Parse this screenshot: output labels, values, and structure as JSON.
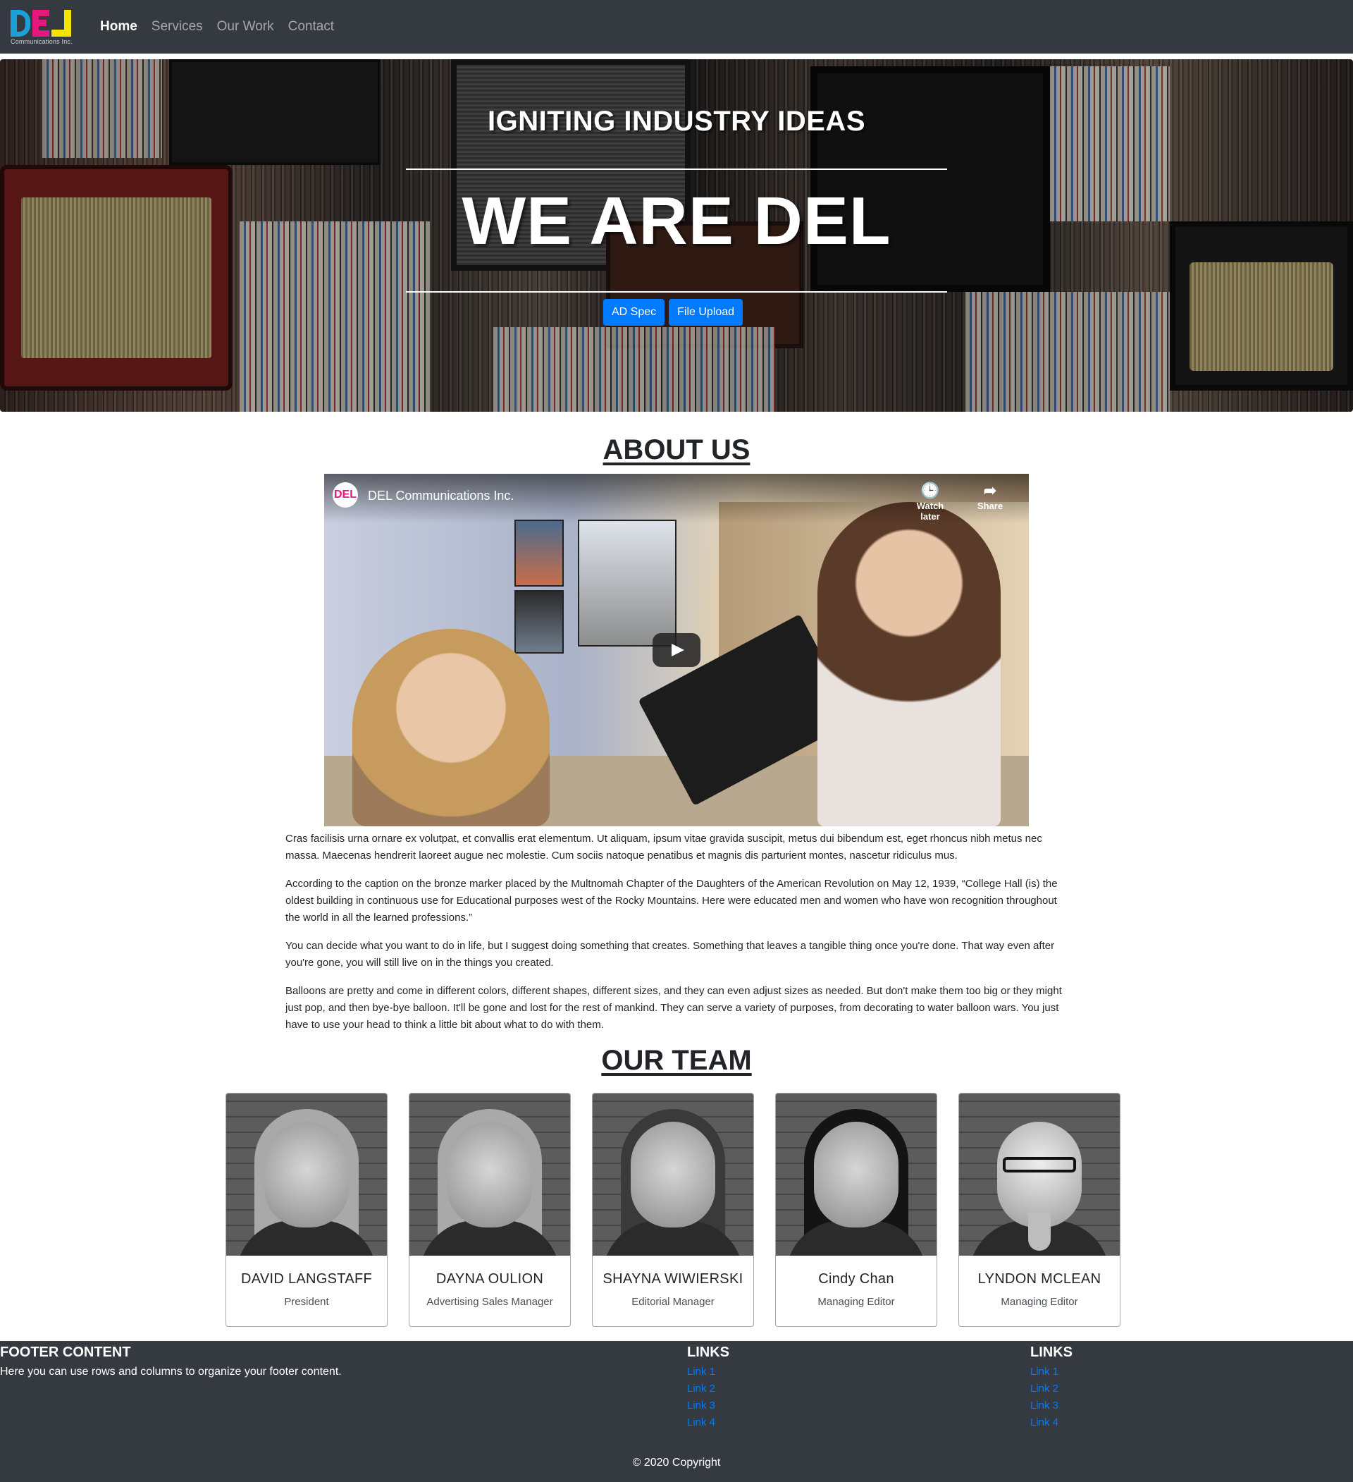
{
  "brand": {
    "logo_letters": [
      "D",
      "E",
      "L"
    ],
    "logo_subtitle": "Communications Inc."
  },
  "nav": {
    "items": [
      {
        "label": "Home",
        "active": true
      },
      {
        "label": "Services",
        "active": false
      },
      {
        "label": "Our Work",
        "active": false
      },
      {
        "label": "Contact",
        "active": false
      }
    ]
  },
  "hero": {
    "tagline": "IGNITING INDUSTRY IDEAS",
    "title": "WE ARE DEL",
    "buttons": [
      "AD Spec",
      "File Upload"
    ]
  },
  "about": {
    "title": "ABOUT US",
    "video": {
      "channel_icon": "DEL",
      "channel_title": "DEL Communications Inc.",
      "watch_later_label": "Watch later",
      "share_label": "Share"
    },
    "paragraphs": [
      "Cras facilisis urna ornare ex volutpat, et convallis erat elementum. Ut aliquam, ipsum vitae gravida suscipit, metus dui bibendum est, eget rhoncus nibh metus nec massa. Maecenas hendrerit laoreet augue nec molestie. Cum sociis natoque penatibus et magnis dis parturient montes, nascetur ridiculus mus.",
      "According to the caption on the bronze marker placed by the Multnomah Chapter of the Daughters of the American Revolution on May 12, 1939, “College Hall (is) the oldest building in continuous use for Educational purposes west of the Rocky Mountains. Here were educated men and women who have won recognition throughout the world in all the learned professions.”",
      "You can decide what you want to do in life, but I suggest doing something that creates. Something that leaves a tangible thing once you're done. That way even after you're gone, you will still live on in the things you created.",
      "Balloons are pretty and come in different colors, different shapes, different sizes, and they can even adjust sizes as needed. But don't make them too big or they might just pop, and then bye-bye balloon. It'll be gone and lost for the rest of mankind. They can serve a variety of purposes, from decorating to water balloon wars. You just have to use your head to think a little bit about what to do with them."
    ]
  },
  "team": {
    "title": "OUR TEAM",
    "members": [
      {
        "name": "DAVID LANGSTAFF",
        "role": "President"
      },
      {
        "name": "DAYNA OULION",
        "role": "Advertising Sales Manager"
      },
      {
        "name": "SHAYNA WIWIERSKI",
        "role": "Editorial Manager"
      },
      {
        "name": "Cindy Chan",
        "role": "Managing Editor"
      },
      {
        "name": "LYNDON MCLEAN",
        "role": "Managing Editor"
      }
    ]
  },
  "footer": {
    "heading": "FOOTER CONTENT",
    "text": "Here you can use rows and columns to organize your footer content.",
    "link_columns": [
      {
        "heading": "LINKS",
        "links": [
          "Link 1",
          "Link 2",
          "Link 3",
          "Link 4"
        ]
      },
      {
        "heading": "LINKS",
        "links": [
          "Link 1",
          "Link 2",
          "Link 3",
          "Link 4"
        ]
      }
    ],
    "copyright": "© 2020 Copyright"
  },
  "colors": {
    "navbar": "#343a40",
    "primary": "#007bff",
    "logo_cyan": "#1ba1d8",
    "logo_magenta": "#e6177d",
    "logo_yellow": "#f5e400"
  },
  "icons": {
    "clock": "clock-icon",
    "share": "share-icon",
    "play": "play-icon"
  }
}
